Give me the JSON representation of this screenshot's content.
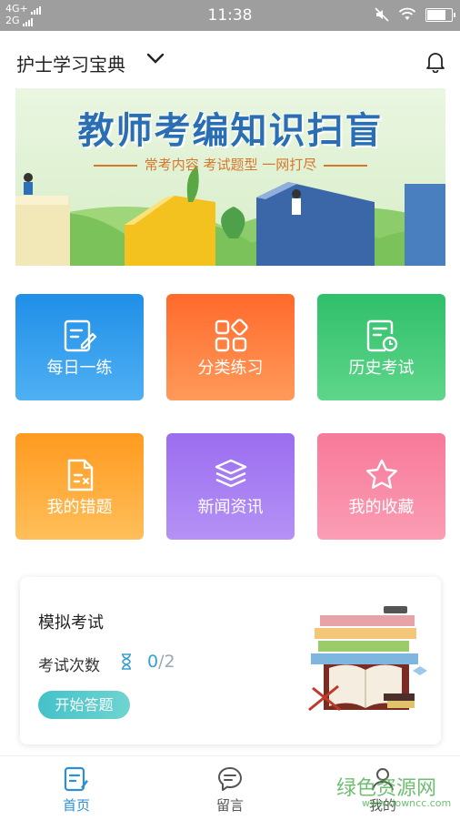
{
  "status_bar": {
    "network_top": "4G+",
    "network_bottom": "2G",
    "time": "11:38",
    "battery_level": 0.85
  },
  "header": {
    "title": "护士学习宝典"
  },
  "banner": {
    "title": "教师考编知识扫盲",
    "subtitle": "常考内容 考试题型 一网打尽"
  },
  "grid": [
    {
      "label": "每日一练",
      "icon": "edit-note-icon",
      "color_from": "#1f8fe8",
      "color_to": "#4fb0f3"
    },
    {
      "label": "分类练习",
      "icon": "category-icon",
      "color_from": "#ff6a2b",
      "color_to": "#ff9a5a"
    },
    {
      "label": "历史考试",
      "icon": "history-doc-icon",
      "color_from": "#2fbf6a",
      "color_to": "#5fd68a"
    },
    {
      "label": "我的错题",
      "icon": "wrong-doc-icon",
      "color_from": "#ff9a1f",
      "color_to": "#ffbf5a"
    },
    {
      "label": "新闻资讯",
      "icon": "layers-icon",
      "color_from": "#9b6df0",
      "color_to": "#b592f5"
    },
    {
      "label": "我的收藏",
      "icon": "star-icon",
      "color_from": "#f7799a",
      "color_to": "#fb9db4"
    }
  ],
  "exam": {
    "title": "模拟考试",
    "count_label": "考试次数",
    "count_done": "0",
    "count_total": "/2",
    "start_label": "开始答题"
  },
  "bottom_nav": [
    {
      "label": "首页",
      "icon": "home-doc-icon",
      "active": true
    },
    {
      "label": "留言",
      "icon": "message-icon",
      "active": false
    },
    {
      "label": "我的",
      "icon": "user-icon",
      "active": false
    }
  ],
  "watermark": {
    "text": "绿色资源网",
    "url": "www.downcc.com"
  },
  "colors": {
    "accent": "#2d8ed6",
    "status_bar": "#9e9e9e"
  }
}
